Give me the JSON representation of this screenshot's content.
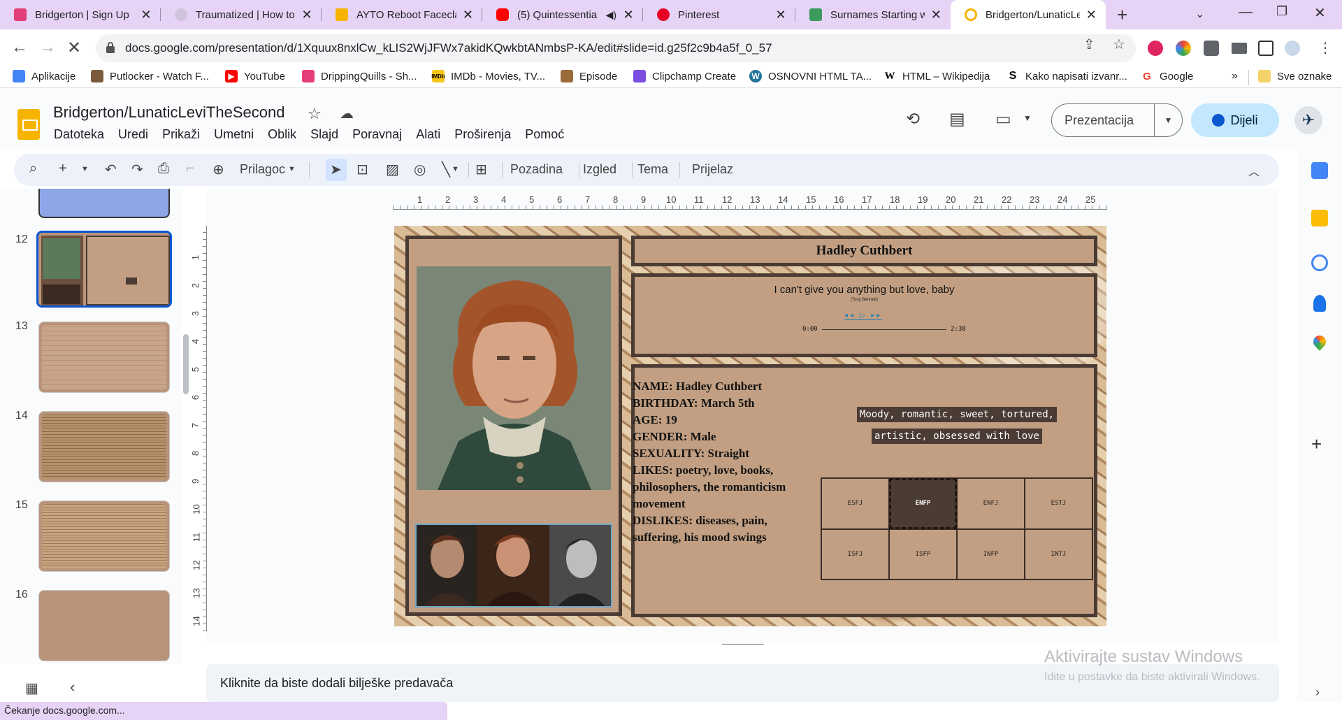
{
  "browser": {
    "tabs": [
      {
        "title": "Bridgerton | Sign Up",
        "color": "#e33d7a"
      },
      {
        "title": "Traumatized | How to",
        "color": "#d0c4dc"
      },
      {
        "title": "AYTO Reboot Facecla",
        "color": "#f6b400"
      },
      {
        "title": "(5) Quintessentia",
        "color": "#ff0000"
      },
      {
        "title": "Pinterest",
        "color": "#e60023"
      },
      {
        "title": "Surnames Starting w",
        "color": "#3a9b5c"
      },
      {
        "title": "Bridgerton/LunaticLe",
        "color": "#f6b400"
      }
    ],
    "url": "docs.google.com/presentation/d/1Xquux8nxlCw_kLIS2WjJFWx7akidKQwkbtANmbsP-KA/edit#slide=id.g25f2c9b4a5f_0_57",
    "bookmarks": [
      {
        "label": "Aplikacije",
        "color": "#4285f4"
      },
      {
        "label": "Putlocker - Watch F...",
        "color": "#7a5a3a"
      },
      {
        "label": "YouTube",
        "color": "#ff0000"
      },
      {
        "label": "DrippingQuills - Sh...",
        "color": "#e33d7a"
      },
      {
        "label": "IMDb - Movies, TV...",
        "color": "#f5c518"
      },
      {
        "label": "Episode",
        "color": "#9b6b3a"
      },
      {
        "label": "Clipchamp Create",
        "color": "#7b4de0"
      },
      {
        "label": "OSNOVNI HTML TA...",
        "color": "#21759b"
      },
      {
        "label": "HTML – Wikipedija",
        "color": "#333333"
      },
      {
        "label": "Kako napisati izvanr...",
        "color": "#111111"
      },
      {
        "label": "Google",
        "color": "#ea4335"
      }
    ],
    "bookmarks_more": "»",
    "bookmarks_folder": "Sve oznake",
    "status": "Čekanje docs.google.com..."
  },
  "slides": {
    "doc_title": "Bridgerton/LunaticLeviTheSecond",
    "menus": [
      "Datoteka",
      "Uredi",
      "Prikaži",
      "Umetni",
      "Oblik",
      "Slajd",
      "Poravnaj",
      "Alati",
      "Proširenja",
      "Pomoć"
    ],
    "present_label": "Prezentacija",
    "share_label": "Dijeli",
    "toolbar": {
      "zoom_label": "Prilagoc",
      "background": "Pozadina",
      "layout": "Izgled",
      "theme": "Tema",
      "transition": "Prijelaz"
    },
    "thumb_numbers": [
      "12",
      "13",
      "14",
      "15",
      "16"
    ],
    "ruler_h": [
      "1",
      "2",
      "3",
      "4",
      "5",
      "6",
      "7",
      "8",
      "9",
      "10",
      "11",
      "12",
      "13",
      "14",
      "15",
      "16",
      "17",
      "18",
      "19",
      "20",
      "21",
      "22",
      "23",
      "24",
      "25"
    ],
    "ruler_v": [
      "1",
      "2",
      "3",
      "4",
      "5",
      "6",
      "7",
      "8",
      "9",
      "10",
      "11",
      "12",
      "13",
      "14"
    ],
    "notes_placeholder": "Kliknite da biste dodali bilješke predavača",
    "watermark_title": "Aktivirajte sustav Windows",
    "watermark_sub": "Idite u postavke da biste aktivirali Windows."
  },
  "slide": {
    "name": "Hadley Cuthbert",
    "song": "I can't give you anything but love, baby",
    "artist": "(Tony Bennett)",
    "player_controls": "◂◂ ▷ ▸▸",
    "time_start": "0:00",
    "time_end": "2:38",
    "bio": [
      "NAME: Hadley Cuthbert",
      "BIRTHDAY: March 5th",
      "AGE: 19",
      "GENDER: Male",
      "SEXUALITY: Straight",
      "LIKES:  poetry, love, books, philosophers, the romanticism movement",
      "DISLIKES: diseases, pain, suffering, his mood swings"
    ],
    "traits_line1": "Moody, romantic, sweet, tortured,",
    "traits_line2": "artistic, obsessed with love",
    "mbti": [
      "ESFJ",
      "ENFP",
      "ENFJ",
      "ESTJ",
      "ISFJ",
      "ISFP",
      "INFP",
      "INTJ"
    ],
    "mbti_selected": "ENFP"
  }
}
